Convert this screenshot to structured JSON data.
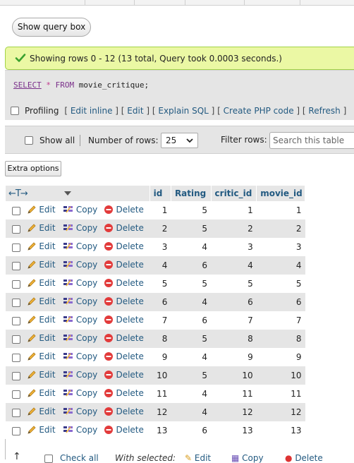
{
  "query_box": {
    "show_label": "Show query box"
  },
  "success": {
    "message": "Showing rows 0 - 12 (13 total, Query took 0.0003 seconds.)"
  },
  "sql": {
    "select": "SELECT",
    "star": "*",
    "from": "FROM",
    "rest": "movie_critique;"
  },
  "profiling": {
    "label": "Profiling",
    "link_edit_inline": "Edit inline",
    "link_edit": "Edit",
    "link_explain": "Explain SQL",
    "link_php": "Create PHP code",
    "link_refresh": "Refresh"
  },
  "navigation": {
    "show_all_label": "Show all",
    "rows_label": "Number of rows:",
    "rows_value": "25",
    "filter_label": "Filter rows:",
    "search_placeholder": "Search this table"
  },
  "extra_options_label": "Extra options",
  "table": {
    "columns": [
      "id",
      "Rating",
      "critic_id",
      "movie_id"
    ],
    "actions": {
      "edit": "Edit",
      "copy": "Copy",
      "delete": "Delete"
    },
    "rows": [
      [
        "1",
        "5",
        "1",
        "1"
      ],
      [
        "2",
        "5",
        "2",
        "2"
      ],
      [
        "3",
        "4",
        "3",
        "3"
      ],
      [
        "4",
        "6",
        "4",
        "4"
      ],
      [
        "5",
        "5",
        "5",
        "5"
      ],
      [
        "6",
        "4",
        "6",
        "6"
      ],
      [
        "7",
        "6",
        "7",
        "7"
      ],
      [
        "8",
        "5",
        "8",
        "8"
      ],
      [
        "9",
        "4",
        "9",
        "9"
      ],
      [
        "10",
        "5",
        "10",
        "10"
      ],
      [
        "11",
        "4",
        "11",
        "11"
      ],
      [
        "12",
        "4",
        "12",
        "12"
      ],
      [
        "13",
        "6",
        "13",
        "13"
      ]
    ]
  },
  "bottom": {
    "check_all": "Check all",
    "with_selected": "With selected:",
    "edit": "Edit",
    "copy": "Copy",
    "delete": "Delete"
  },
  "colors": {
    "success_bg": "#ebf8a4",
    "link": "#235a81",
    "delete_red": "#d33"
  }
}
